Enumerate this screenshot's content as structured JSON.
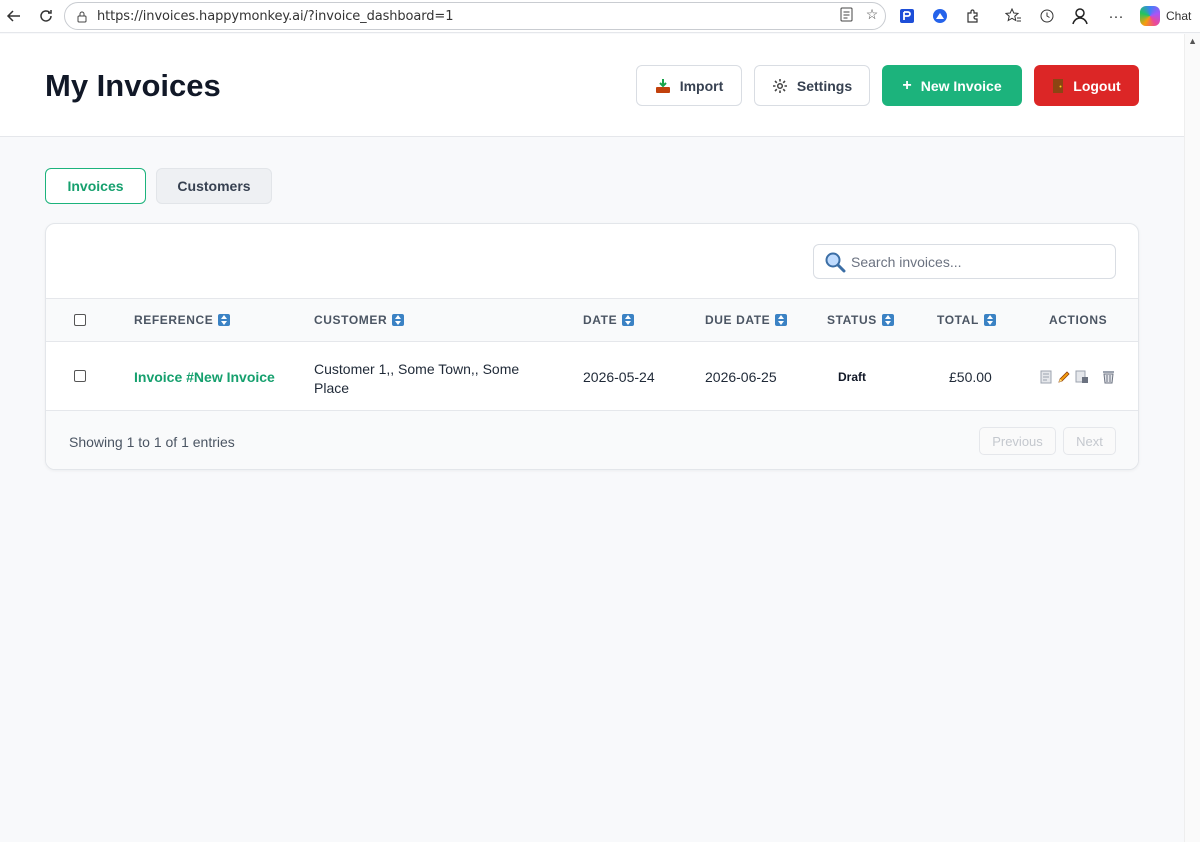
{
  "browser": {
    "url": "https://invoices.happymonkey.ai/?invoice_dashboard=1",
    "chat_label": "Chat"
  },
  "header": {
    "title": "My Invoices",
    "import_label": "Import",
    "settings_label": "Settings",
    "new_invoice_label": "New Invoice",
    "logout_label": "Logout"
  },
  "tabs": [
    {
      "label": "Invoices",
      "active": true
    },
    {
      "label": "Customers",
      "active": false
    }
  ],
  "search": {
    "placeholder": "Search invoices..."
  },
  "table": {
    "columns": [
      "REFERENCE",
      "CUSTOMER",
      "DATE",
      "DUE DATE",
      "STATUS",
      "TOTAL",
      "ACTIONS"
    ],
    "rows": [
      {
        "reference": "Invoice #New Invoice",
        "customer": "Customer 1,, Some Town,, Some Place",
        "date": "2026-05-24",
        "due_date": "2026-06-25",
        "status": "Draft",
        "total": "£50.00"
      }
    ]
  },
  "footer": {
    "showing": "Showing 1 to 1 of 1 entries",
    "previous_label": "Previous",
    "next_label": "Next"
  },
  "colors": {
    "accent": "#1cb37c",
    "danger": "#dc2626",
    "sort_icon": "#3b82c4"
  }
}
